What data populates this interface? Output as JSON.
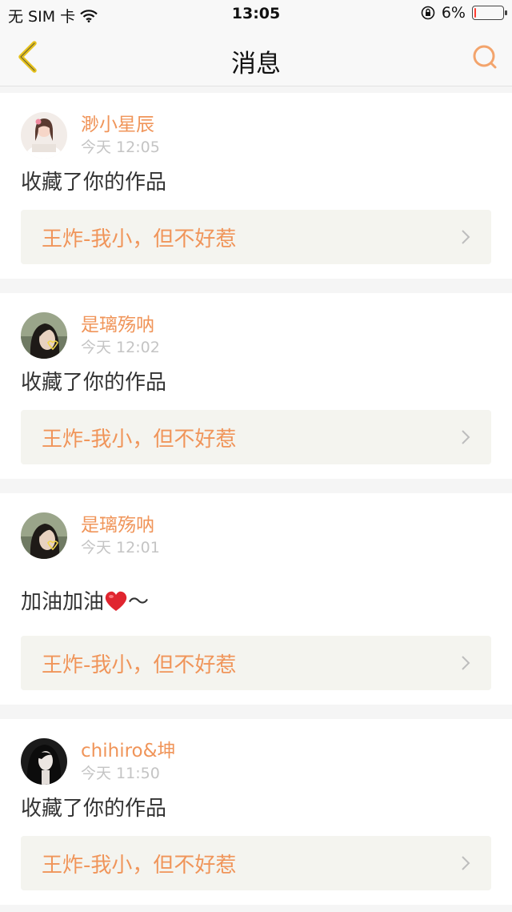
{
  "status_bar": {
    "carrier": "无 SIM 卡",
    "time": "13:05",
    "battery_percent": "6%",
    "battery_level": 0.06
  },
  "nav": {
    "title": "消息",
    "back_icon": "chevron-left-icon",
    "search_icon": "search-icon"
  },
  "colors": {
    "accent": "#f0955a",
    "back_icon": "#e6c21d",
    "search_icon": "#f3a46c"
  },
  "messages": [
    {
      "username": "渺小星辰",
      "time": "今天 12:05",
      "text": "收藏了你的作品",
      "work_title": "王炸-我小，但不好惹"
    },
    {
      "username": "是璃殇呐",
      "time": "今天 12:02",
      "text": "收藏了你的作品",
      "work_title": "王炸-我小，但不好惹"
    },
    {
      "username": "是璃殇呐",
      "time": "今天 12:01",
      "text": "加油加油",
      "text_suffix": "～",
      "work_title": "王炸-我小，但不好惹"
    },
    {
      "username": "chihiro&坤",
      "time": "今天 11:50",
      "text": "收藏了你的作品",
      "work_title": "王炸-我小，但不好惹"
    }
  ]
}
